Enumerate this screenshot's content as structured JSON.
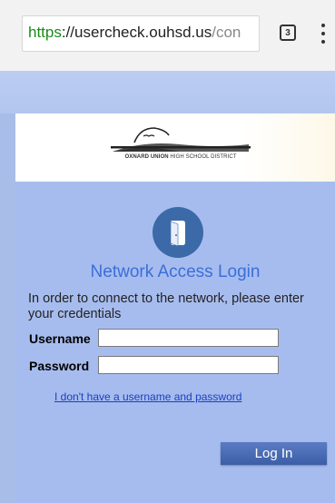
{
  "browser": {
    "url_scheme": "https",
    "url_separator": "://",
    "url_host": "usercheck.ouhsd.us",
    "url_path": "/con",
    "tab_count": "3",
    "menu_icon": "overflow-menu-icon"
  },
  "logo": {
    "name_bold": "OXNARD UNION",
    "name_rest": " HIGH SCHOOL DISTRICT"
  },
  "login": {
    "icon": "door-icon",
    "title": "Network Access Login",
    "instructions": "In order to connect to the network, please enter your credentials",
    "username_label": "Username",
    "username_value": "",
    "password_label": "Password",
    "password_value": "",
    "no_account_link": "I don't have a username and password",
    "submit_label": "Log In"
  },
  "colors": {
    "page_background": "#a9bde9",
    "title_blue": "#3a6fd8",
    "button_blue": "#3b5ea6",
    "icon_circle": "#3c6aa9",
    "url_scheme_green": "#1b8a1b"
  }
}
